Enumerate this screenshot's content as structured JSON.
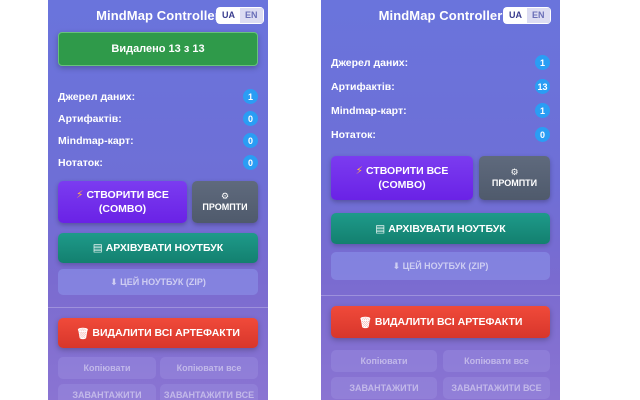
{
  "app": {
    "title": "MindMap Controller"
  },
  "lang": {
    "ua": "UA",
    "en": "EN"
  },
  "banner": {
    "text": "Видалено 13 з 13"
  },
  "labels": {
    "sources": "Джерел даних:",
    "artifacts": "Артифактів:",
    "mindmaps": "Mindmap-карт:",
    "notes": "Нотаток:"
  },
  "left": {
    "sources": "1",
    "artifacts": "0",
    "mindmaps": "0",
    "notes": "0"
  },
  "right": {
    "sources": "1",
    "artifacts": "13",
    "mindmaps": "1",
    "notes": "0"
  },
  "buttons": {
    "combo_line1": "СТВОРИТИ ВСЕ",
    "combo_line2": "(COMBO)",
    "combo_icon": "⚡",
    "prompts": "ПРОМПТИ",
    "prompts_icon": "⚙",
    "archive": "АРХІВУВАТИ НОУТБУК",
    "archive_icon": "▤",
    "zip": "⬇ ЦЕЙ НОУТБУК (ZIP)",
    "delete": "ВИДАЛИТИ ВСІ АРТЕФАКТИ",
    "delete_icon": "🗑",
    "copy": "Копіювати",
    "copy_all": "Копіювати все",
    "download": "ЗАВАНТАЖИТИ",
    "download_all": "ЗАВАНТАЖИТИ ВСЕ"
  },
  "colors": {
    "accent": "#6a22e6",
    "success": "#2f9a4a",
    "danger": "#d8362b",
    "teal": "#13806f",
    "badge": "#2a9df4"
  }
}
